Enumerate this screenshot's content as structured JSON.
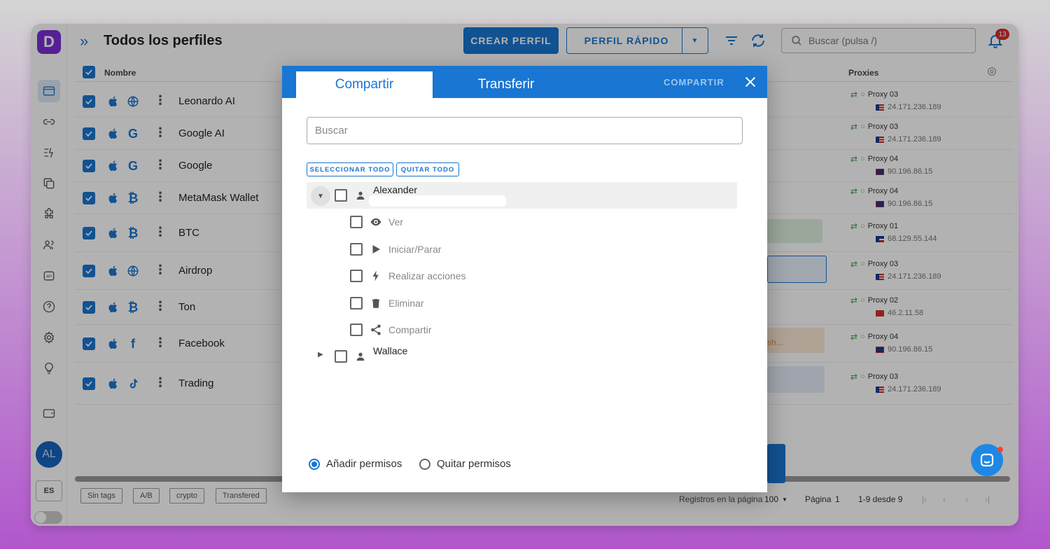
{
  "topbar": {
    "title": "Todos los perfiles",
    "create_label": "CREAR PERFIL",
    "quick_label": "PERFIL RÁPIDO",
    "search_placeholder": "Buscar (pulsa /)",
    "notifications": "13"
  },
  "sidebar": {
    "logo": "D",
    "avatar": "AL",
    "lang": "ES"
  },
  "table": {
    "col_name": "Nombre",
    "col_proxies": "Proxies",
    "rows": [
      {
        "name": "Leonardo AI",
        "icon": "globe",
        "proxy": "Proxy 03",
        "ip": "24.171.236.189",
        "flag": "pr"
      },
      {
        "name": "Google AI",
        "icon": "G",
        "proxy": "Proxy 03",
        "ip": "24.171.236.189",
        "flag": "pr"
      },
      {
        "name": "Google",
        "icon": "G",
        "proxy": "Proxy 04",
        "ip": "90.196.86.15",
        "flag": "uk"
      },
      {
        "name": "MetaMask Wallet",
        "icon": "B",
        "proxy": "Proxy 04",
        "ip": "90.196.86.15",
        "flag": "uk"
      },
      {
        "name": "BTC",
        "icon": "B",
        "proxy": "Proxy 01",
        "ip": "68.129.55.144",
        "flag": "us"
      },
      {
        "name": "Airdrop",
        "icon": "globe",
        "proxy": "Proxy 03",
        "ip": "24.171.236.189",
        "flag": "pr"
      },
      {
        "name": "Ton",
        "icon": "B",
        "proxy": "Proxy 02",
        "ip": "46.2.11.58",
        "flag": "tr"
      },
      {
        "name": "Facebook",
        "icon": "f",
        "proxy": "Proxy 04",
        "ip": "90.196.86.15",
        "flag": "uk"
      },
      {
        "name": "Trading",
        "icon": "tiktok",
        "proxy": "Proxy 03",
        "ip": "24.171.236.189",
        "flag": "pr"
      }
    ],
    "partial_text": "sh..."
  },
  "bottom": {
    "tags": [
      "Sin tags",
      "A/B",
      "crypto",
      "Transfered"
    ],
    "records_label": "Registros en la página",
    "records_value": "100",
    "page_label": "Página",
    "page_value": "1",
    "range": "1-9 desde 9"
  },
  "modal": {
    "tab_share": "Compartir",
    "tab_transfer": "Transferir",
    "submit": "COMPARTIR",
    "search_placeholder": "Buscar",
    "select_all": "SELECCIONAR TODO",
    "remove_all": "QUITAR TODO",
    "users": [
      {
        "name": "Alexander"
      },
      {
        "name": "Wallace"
      }
    ],
    "permissions": [
      {
        "label": "Ver",
        "icon": "eye"
      },
      {
        "label": "Iniciar/Parar",
        "icon": "play"
      },
      {
        "label": "Realizar acciones",
        "icon": "bolt"
      },
      {
        "label": "Eliminar",
        "icon": "trash"
      },
      {
        "label": "Compartir",
        "icon": "share"
      }
    ],
    "add_perm": "Añadir permisos",
    "remove_perm": "Quitar permisos"
  },
  "colors": {
    "accent": "#1976d2",
    "logo": "#7b2fd6",
    "badge": "#d32f2f"
  }
}
